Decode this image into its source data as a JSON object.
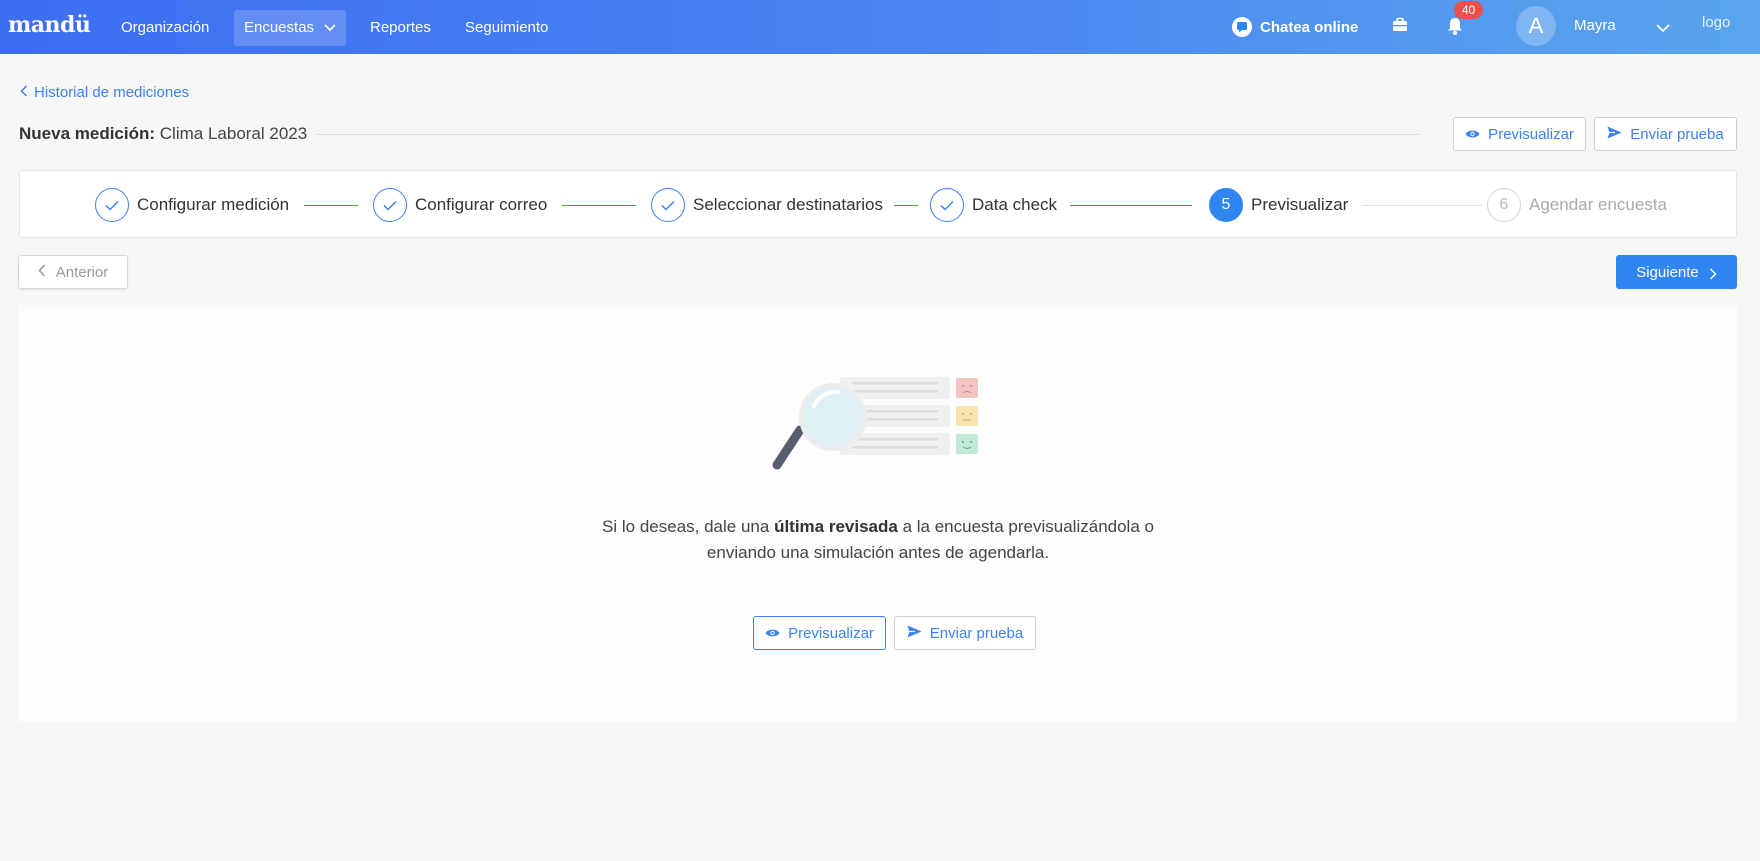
{
  "nav": {
    "brand": "mandü",
    "items": [
      {
        "label": "Organización"
      },
      {
        "label": "Encuestas"
      },
      {
        "label": "Reportes"
      },
      {
        "label": "Seguimiento"
      }
    ],
    "chat_label": "Chatea online",
    "notifications_count": "40",
    "avatar_initial": "A",
    "user_name": "Mayra",
    "logo_alt": "logo"
  },
  "breadcrumb": {
    "back_label": "Historial de mediciones"
  },
  "header": {
    "title_prefix": "Nueva medición:",
    "title_value": "Clima Laboral 2023",
    "preview_label": "Previsualizar",
    "send_test_label": "Enviar prueba"
  },
  "stepper": {
    "steps": [
      {
        "label": "Configurar medición",
        "state": "done"
      },
      {
        "label": "Configurar correo",
        "state": "done"
      },
      {
        "label": "Seleccionar destinatarios",
        "state": "done"
      },
      {
        "label": "Data check",
        "state": "done"
      },
      {
        "number": "5",
        "label": "Previsualizar",
        "state": "active"
      },
      {
        "number": "6",
        "label": "Agendar encuesta",
        "state": "future"
      }
    ]
  },
  "navigation": {
    "previous_label": "Anterior",
    "next_label": "Siguiente"
  },
  "content": {
    "message_part1": "Si lo deseas, dale una",
    "message_bold": "última revisada",
    "message_part2": "a la encuesta previsualizándola o enviando una simulación antes de agendarla.",
    "preview_label": "Previsualizar",
    "send_test_label": "Enviar prueba"
  },
  "colors": {
    "accent": "#2f86f0",
    "nav_start": "#3d6ef2",
    "nav_end": "#5aa5ee",
    "badge": "#e8524b"
  }
}
